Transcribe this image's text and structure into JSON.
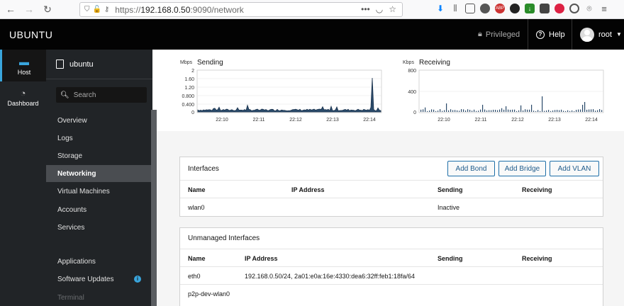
{
  "browser": {
    "url_scheme": "https://",
    "url_host": "192.168.0.50",
    "url_rest": ":9090/network"
  },
  "header": {
    "brand": "UBUNTU",
    "privileged": "Privileged",
    "help": "Help",
    "user": "root"
  },
  "rail": {
    "host": "Host",
    "dashboard": "Dashboard"
  },
  "sidebar": {
    "host_name": "ubuntu",
    "search_placeholder": "Search",
    "items": [
      {
        "label": "Overview"
      },
      {
        "label": "Logs"
      },
      {
        "label": "Storage"
      },
      {
        "label": "Networking"
      },
      {
        "label": "Virtual Machines"
      },
      {
        "label": "Accounts"
      },
      {
        "label": "Services"
      },
      {
        "label": "Applications"
      },
      {
        "label": "Software Updates"
      },
      {
        "label": "Terminal"
      }
    ],
    "active": "Networking"
  },
  "graphs": {
    "sending": {
      "title": "Sending",
      "unit": "Mbps",
      "y_ticks": [
        "2",
        "1.60",
        "1.20",
        "0.800",
        "0.400",
        "0"
      ],
      "x_ticks": [
        "22:10",
        "22:11",
        "22:12",
        "22:13",
        "22:14"
      ]
    },
    "receiving": {
      "title": "Receiving",
      "unit": "Kbps",
      "y_ticks": [
        "800",
        "400",
        "0"
      ],
      "x_ticks": [
        "22:10",
        "22:11",
        "22:12",
        "22:13",
        "22:14"
      ]
    }
  },
  "interfaces": {
    "title": "Interfaces",
    "buttons": {
      "add_bond": "Add Bond",
      "add_bridge": "Add Bridge",
      "add_vlan": "Add VLAN"
    },
    "columns": [
      "Name",
      "IP Address",
      "Sending",
      "Receiving"
    ],
    "rows": [
      {
        "name": "wlan0",
        "ip": "",
        "sending": "Inactive",
        "receiving": ""
      }
    ]
  },
  "unmanaged": {
    "title": "Unmanaged Interfaces",
    "columns": [
      "Name",
      "IP Address",
      "Sending",
      "Receiving"
    ],
    "rows": [
      {
        "name": "eth0",
        "ip": "192.168.0.50/24, 2a01:e0a:16e:4330:dea6:32ff:feb1:18fa/64",
        "sending": "",
        "receiving": ""
      },
      {
        "name": "p2p-dev-wlan0",
        "ip": "",
        "sending": "",
        "receiving": ""
      }
    ]
  }
}
